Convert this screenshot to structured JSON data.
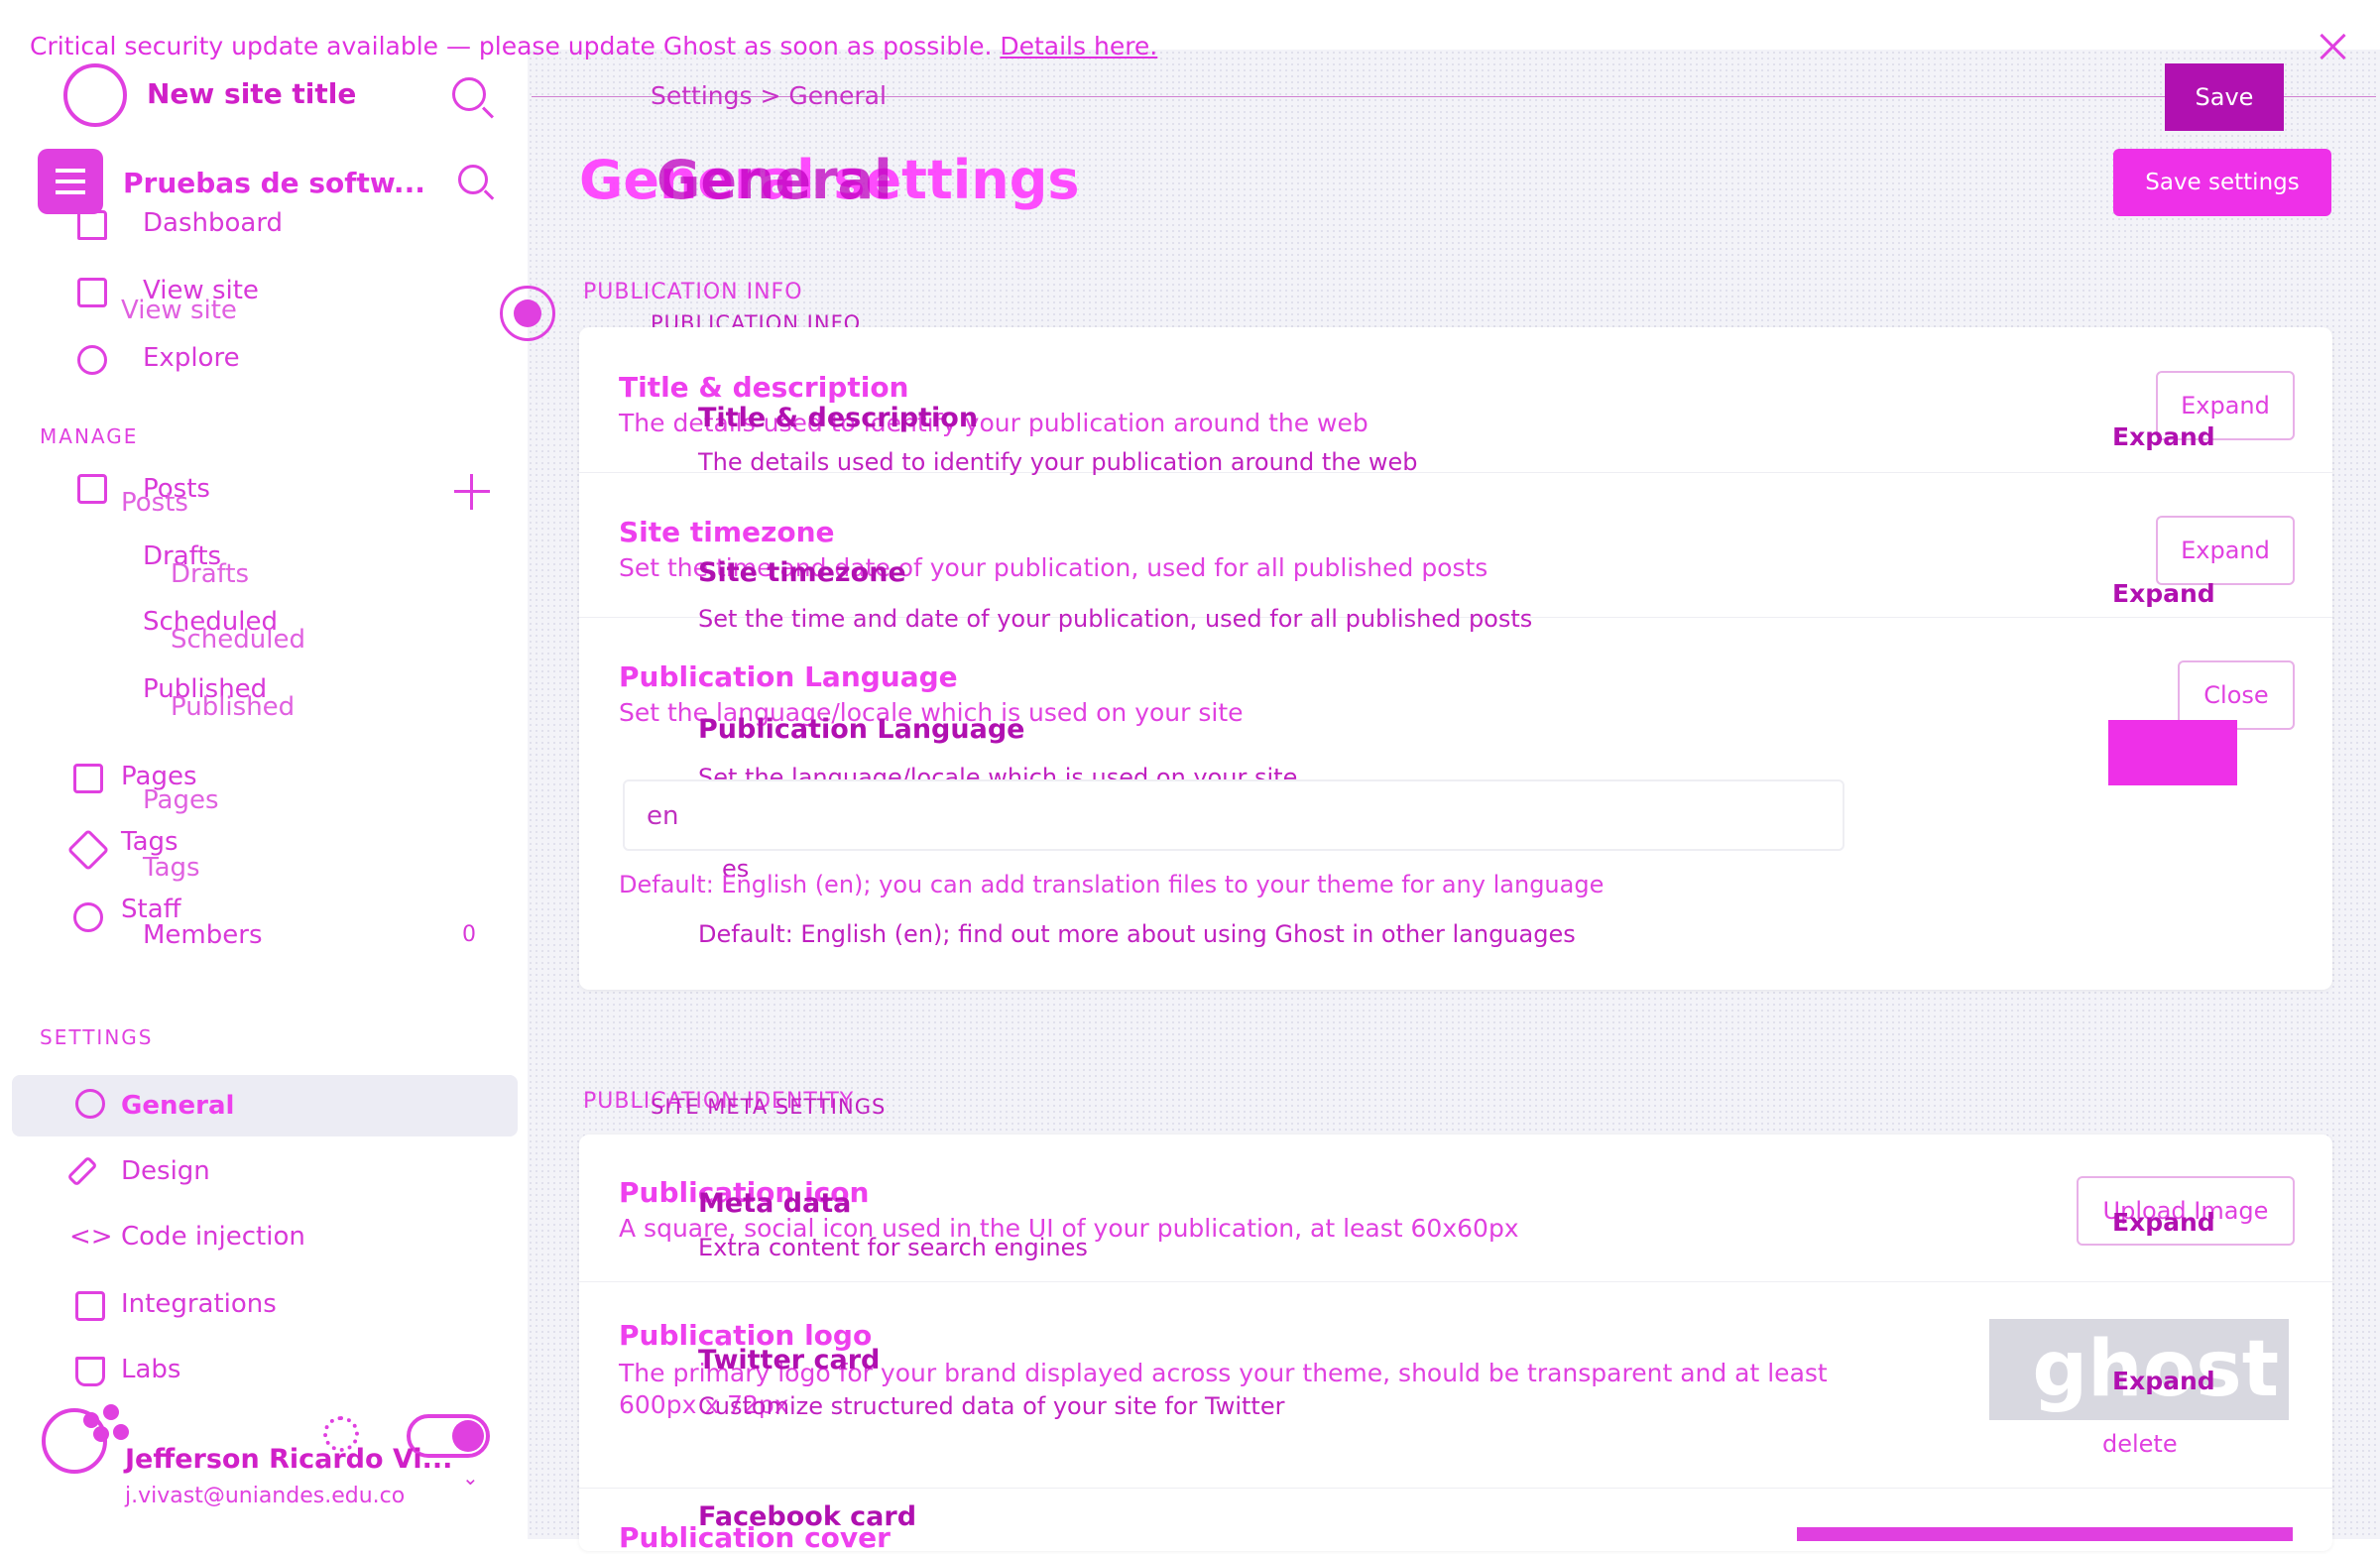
{
  "banner": {
    "text": "Critical security update available — please update Ghost as soon as possible.",
    "link": "Details here."
  },
  "site": {
    "title": "New site title",
    "brand": "Pruebas de softw..."
  },
  "nav": {
    "dashboard": "Dashboard",
    "view_site_a": "View site",
    "view_site_b": "View site",
    "explore": "Explore",
    "manage_label": "MANAGE",
    "posts_a": "Posts",
    "posts_b": "Posts",
    "drafts_a": "Drafts",
    "drafts_b": "Drafts",
    "scheduled_a": "Scheduled",
    "scheduled_b": "Scheduled",
    "published_a": "Published",
    "published_b": "Published",
    "pages_a": "Pages",
    "pages_b": "Pages",
    "tags_a": "Tags",
    "tags_b": "Tags",
    "staff": "Staff",
    "members": "Members",
    "members_count": "0",
    "settings_label": "SETTINGS",
    "general": "General",
    "design": "Design",
    "code_injection": "Code injection",
    "integrations": "Integrations",
    "labs": "Labs"
  },
  "user": {
    "name": "Jefferson Ricardo Vi...",
    "email": "j.vivast@uniandes.edu.co"
  },
  "header": {
    "breadcrumb": "Settings  >  General",
    "save_small": "Save",
    "save_settings": "Save settings",
    "title_a": "General settings",
    "title_b": "General"
  },
  "section1": {
    "label_a": "PUBLICATION INFO",
    "label_b": "PUBLICATION INFO"
  },
  "rows": {
    "title_desc": {
      "head": "Title & description",
      "desc": "The details used to identify your publication around the web",
      "btn": "Expand",
      "o_head": "Title & description",
      "o_desc": "The details used to identify your publication around the web",
      "o_btn": "Expand"
    },
    "timezone": {
      "head": "Site timezone",
      "desc": "Set the time and date of your publication, used for all published posts",
      "btn": "Expand",
      "o_head": "Site timezone",
      "o_desc": "Set the time and date of your publication, used for all published posts",
      "o_btn": "Expand"
    },
    "language": {
      "head": "Publication Language",
      "desc": "Set the language/locale which is used on your site",
      "btn": "Close",
      "o_head": "Publication Language",
      "o_desc": "Set the language/locale which is used on your site",
      "input_value": "en",
      "overlay_value": "es",
      "default_a": "Default: English (en); you can add translation files to your theme for any language",
      "default_b": "Default: English (en); find out more about using Ghost in other languages"
    }
  },
  "section2": {
    "label_a": "PUBLICATION IDENTITY",
    "label_b": "SITE META SETTINGS"
  },
  "identity": {
    "icon_head": "Publication icon",
    "icon_desc": "A square, social icon used in the UI of your publication, at least 60x60px",
    "icon_btn": "Upload Image",
    "meta_head": "Meta data",
    "meta_desc": "Extra content for search engines",
    "meta_btn": "Expand",
    "logo_head": "Publication logo",
    "logo_desc_1": "The primary logo for your brand displayed across your theme, should be transparent and at least",
    "logo_desc_2": "600px x 72px",
    "twitter_head": "Twitter card",
    "twitter_desc": "Customize structured data of your site for Twitter",
    "twitter_btn": "Expand",
    "logo_image": "ghost",
    "delete": "delete",
    "cover_head": "Publication cover",
    "facebook_head": "Facebook card"
  }
}
